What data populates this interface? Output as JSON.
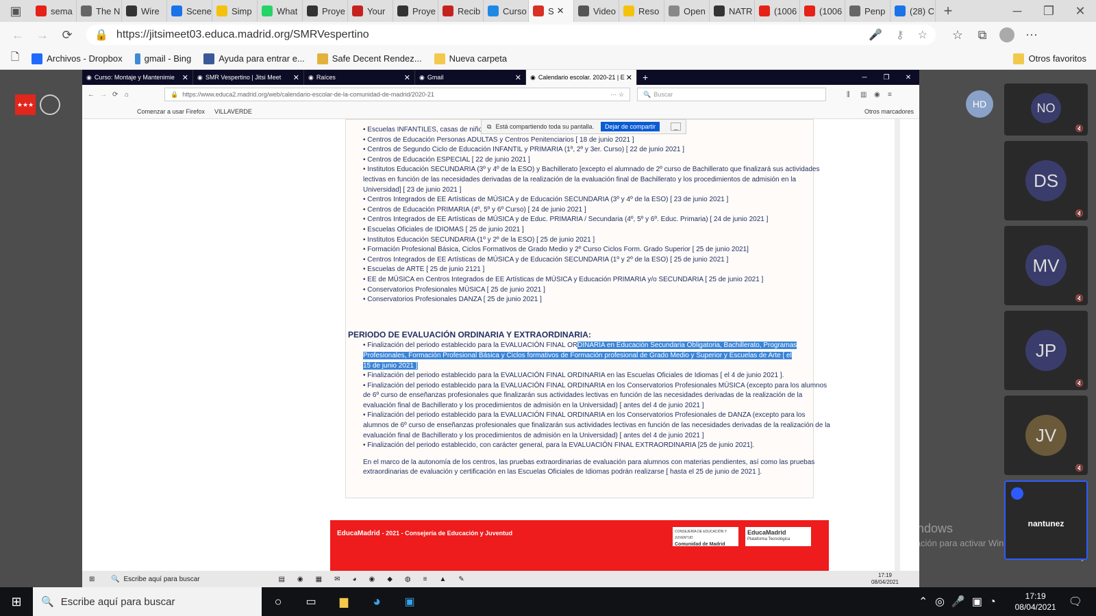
{
  "edge": {
    "tabs": [
      "sema",
      "The N",
      "Wire",
      "Scene",
      "Simp",
      "What",
      "Proye",
      "Your",
      "Proye",
      "Recib",
      "Curso",
      "S",
      "Video",
      "Reso",
      "Open",
      "NATR",
      "(1006",
      "(1006",
      "Penp",
      "(28) C"
    ],
    "url": "https://jitsimeet03.educa.madrid.org/SMRVespertino",
    "favorites": [
      "Archivos - Dropbox",
      "gmail - Bing",
      "Ayuda para entrar e...",
      "Safe Decent Rendez...",
      "Nueva carpeta"
    ],
    "other_favorites": "Otros favoritos"
  },
  "firefox": {
    "tabs": [
      "Curso: Montaje y Mantenimie",
      "SMR Vespertino | Jitsi Meet",
      "Raíces",
      "Gmail",
      "Calendario escolar. 2020-21 | E"
    ],
    "url": "https://www.educa2.madrid.org/web/calendario-escolar-de-la-comunidad-de-madrid/2020-21",
    "search_placeholder": "Buscar",
    "bookmarks": [
      "Comenzar a usar Firefox",
      "VILLAVERDE"
    ],
    "other_bookmarks": "Otros marcadores",
    "share_text": "Está compartiendo toda su pantalla.",
    "share_button": "Dejar de compartir",
    "taskbar_search": "Escribe aquí para buscar",
    "taskbar_time": "17:19",
    "taskbar_date": "08/04/2021"
  },
  "page": {
    "list1": [
      "• Escuelas INFANTILES, casas de niños ...",
      "• Centros de Educación Personas ADULTAS y Centros Penitenciarios [ 18 de junio 2021 ]",
      "• Centros de Segundo Ciclo de Educación INFANTIL y PRIMARIA (1º, 2º y 3er. Curso) [ 22 de junio 2021 ]",
      "• Centros de Educación ESPECIAL [ 22 de junio 2021 ]",
      "• Institutos Educación SECUNDARIA (3º y 4º de la ESO) y Bachillerato [excepto el alumnado de 2º curso de Bachillerato que finalizará sus actividades",
      "lectivas en función de las necesidades derivadas de la realización de la evaluación final de Bachillerato y los procedimientos de admisión en la",
      "Universidad] [ 23 de junio 2021 ]",
      "• Centros Integrados de EE Artísticas de MÚSICA y de Educación SECUNDARIA (3º y 4º de la ESO) [ 23 de junio 2021 ]",
      "• Centros de Educación PRIMARIA (4º, 5º y 6º Curso) [ 24 de junio 2021 ]",
      "• Centros Integrados de EE Artísticas de MÚSICA y de Educ. PRIMARIA / Secundaria (4º, 5º y 6º. Educ. Primaria) [ 24 de junio 2021 ]",
      "• Escuelas Oficiales de IDIOMAS [ 25 de junio 2021 ]",
      "• Institutos Educación SECUNDARIA (1º y 2º de la ESO) [ 25 de junio 2021 ]",
      "• Formación Profesional Básica, Ciclos Formativos de Grado Medio y 2º Curso Ciclos Form. Grado Superior [ 25 de junio 2021]",
      "• Centros Integrados de EE Artísticas de MÚSICA y de Educación SECUNDARIA (1º y 2º de la ESO) [ 25 de junio 2021 ]",
      "• Escuelas de ARTE [ 25 de junio 2121 ]",
      "• EE de MÚSICA en Centros Integrados de EE Artísticas de MÚSICA y Educación PRIMARIA y/o SECUNDARIA [ 25 de junio 2021 ]",
      "• Conservatorios Profesionales MÚSICA [ 25 de junio 2021 ]",
      "• Conservatorios Profesionales DANZA [ 25 de junio 2021 ]"
    ],
    "section_title": "PERIODO DE EVALUACIÓN ORDINARIA Y EXTRAORDINARIA:",
    "list2_first_plain": "• Finalización del periodo establecido para la EVALUACIÓN FINAL OR",
    "list2_first_hl": "DINARIA en Educación Secundaria Obligatoria, Bachillerato, Programas",
    "list2_hl_lines": [
      "Profesionales, Formación Profesional Básica y Ciclos formativos de Formación profesional de Grado Medio y Superior y Escuelas de Arte [ el",
      "15 de junio 2021 ]"
    ],
    "list2": [
      "• Finalización del periodo establecido para la EVALUACIÓN FINAL ORDINARIA en las Escuelas Oficiales de Idiomas [ el 4 de junio 2021 ].",
      "• Finalización del periodo establecido para la EVALUACIÓN FINAL ORDINARIA en los Conservatorios Profesionales MÚSICA (excepto para los alumnos",
      "de 6º curso de enseñanzas profesionales que finalizarán sus actividades lectivas en función de las necesidades derivadas de la realización de la",
      "evaluación final de Bachillerato y los procedimientos de admisión en la Universidad) [ antes del 4 de junio 2021 ]",
      "• Finalización del periodo establecido para la EVALUACIÓN FINAL ORDINARIA en los Conservatorios Profesionales de DANZA (excepto para los",
      "alumnos de 6º curso de enseñanzas profesionales que finalizarán sus actividades lectivas en función de las necesidades derivadas de la realización de la",
      "evaluación final de Bachillerato y los procedimientos de admisión en la Universidad) [ antes del 4 de junio 2021 ]",
      "• Finalización del periodo establecido, con carácter general, para la EVALUACIÓN FINAL EXTRAORDINARIA [25 de junio 2021].",
      "En el marco de la autonomía de los centros, las pruebas extraordinarias de evaluación para alumnos con materias pendientes, así como las pruebas",
      "extraordinarias de evaluación y certificación en las Escuelas Oficiales de Idiomas podrán realizarse [ hasta el 25 de junio de 2021 ]."
    ],
    "footer_brand": "EducaMadrid",
    "footer_text": "- 2021 - Consejería de Educación y Juventud",
    "logo1_line1": "CONSEJERÍA DE EDUCACIÓN Y JUVENTUD",
    "logo1_line2": "Comunidad de Madrid",
    "logo2_line1": "EducaMadrid",
    "logo2_line2": "Plataforma Tecnológica"
  },
  "jitsi": {
    "self_avatar": "HD",
    "participants": [
      "NO",
      "DS",
      "MV",
      "JP",
      "JV"
    ],
    "local_name": "nantunez",
    "activate_title": "Activar Windows",
    "activate_sub": "Ve a Configuración para activar Windows."
  },
  "taskbar": {
    "search": "Escribe aquí para buscar",
    "time": "17:19",
    "date": "08/04/2021"
  }
}
